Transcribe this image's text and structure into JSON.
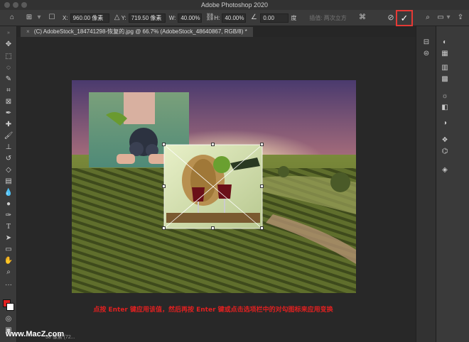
{
  "app": {
    "title": "Adobe Photoshop 2020"
  },
  "options": {
    "x_label": "X:",
    "x_value": "960.00 像素",
    "y_label": "Y:",
    "y_value": "719.50 像素",
    "w_label": "W:",
    "w_value": "40.00%",
    "h_label": "H:",
    "h_value": "40.00%",
    "angle_value": "0.00",
    "angle_unit": "度",
    "interp_label": "插值: 两次立方",
    "confirm_glyph": "✓",
    "cancel_glyph": "⊘"
  },
  "document": {
    "tab_label": "(C) AdobeStock_184741298-恢复的.jpg @ 66.7% (AdobeStock_48640867, RGB/8) *"
  },
  "caption": "点按 Enter 键应用该值，然后再按 Enter 键或点击选项栏中的对勾图标来应用变换",
  "watermark": "www.MacZ.com",
  "status": "38 像素 (72...",
  "colors": {
    "accent_red": "#e53935",
    "caption_red": "#e02020",
    "foreground": "#e02020",
    "background": "#ffffff"
  }
}
